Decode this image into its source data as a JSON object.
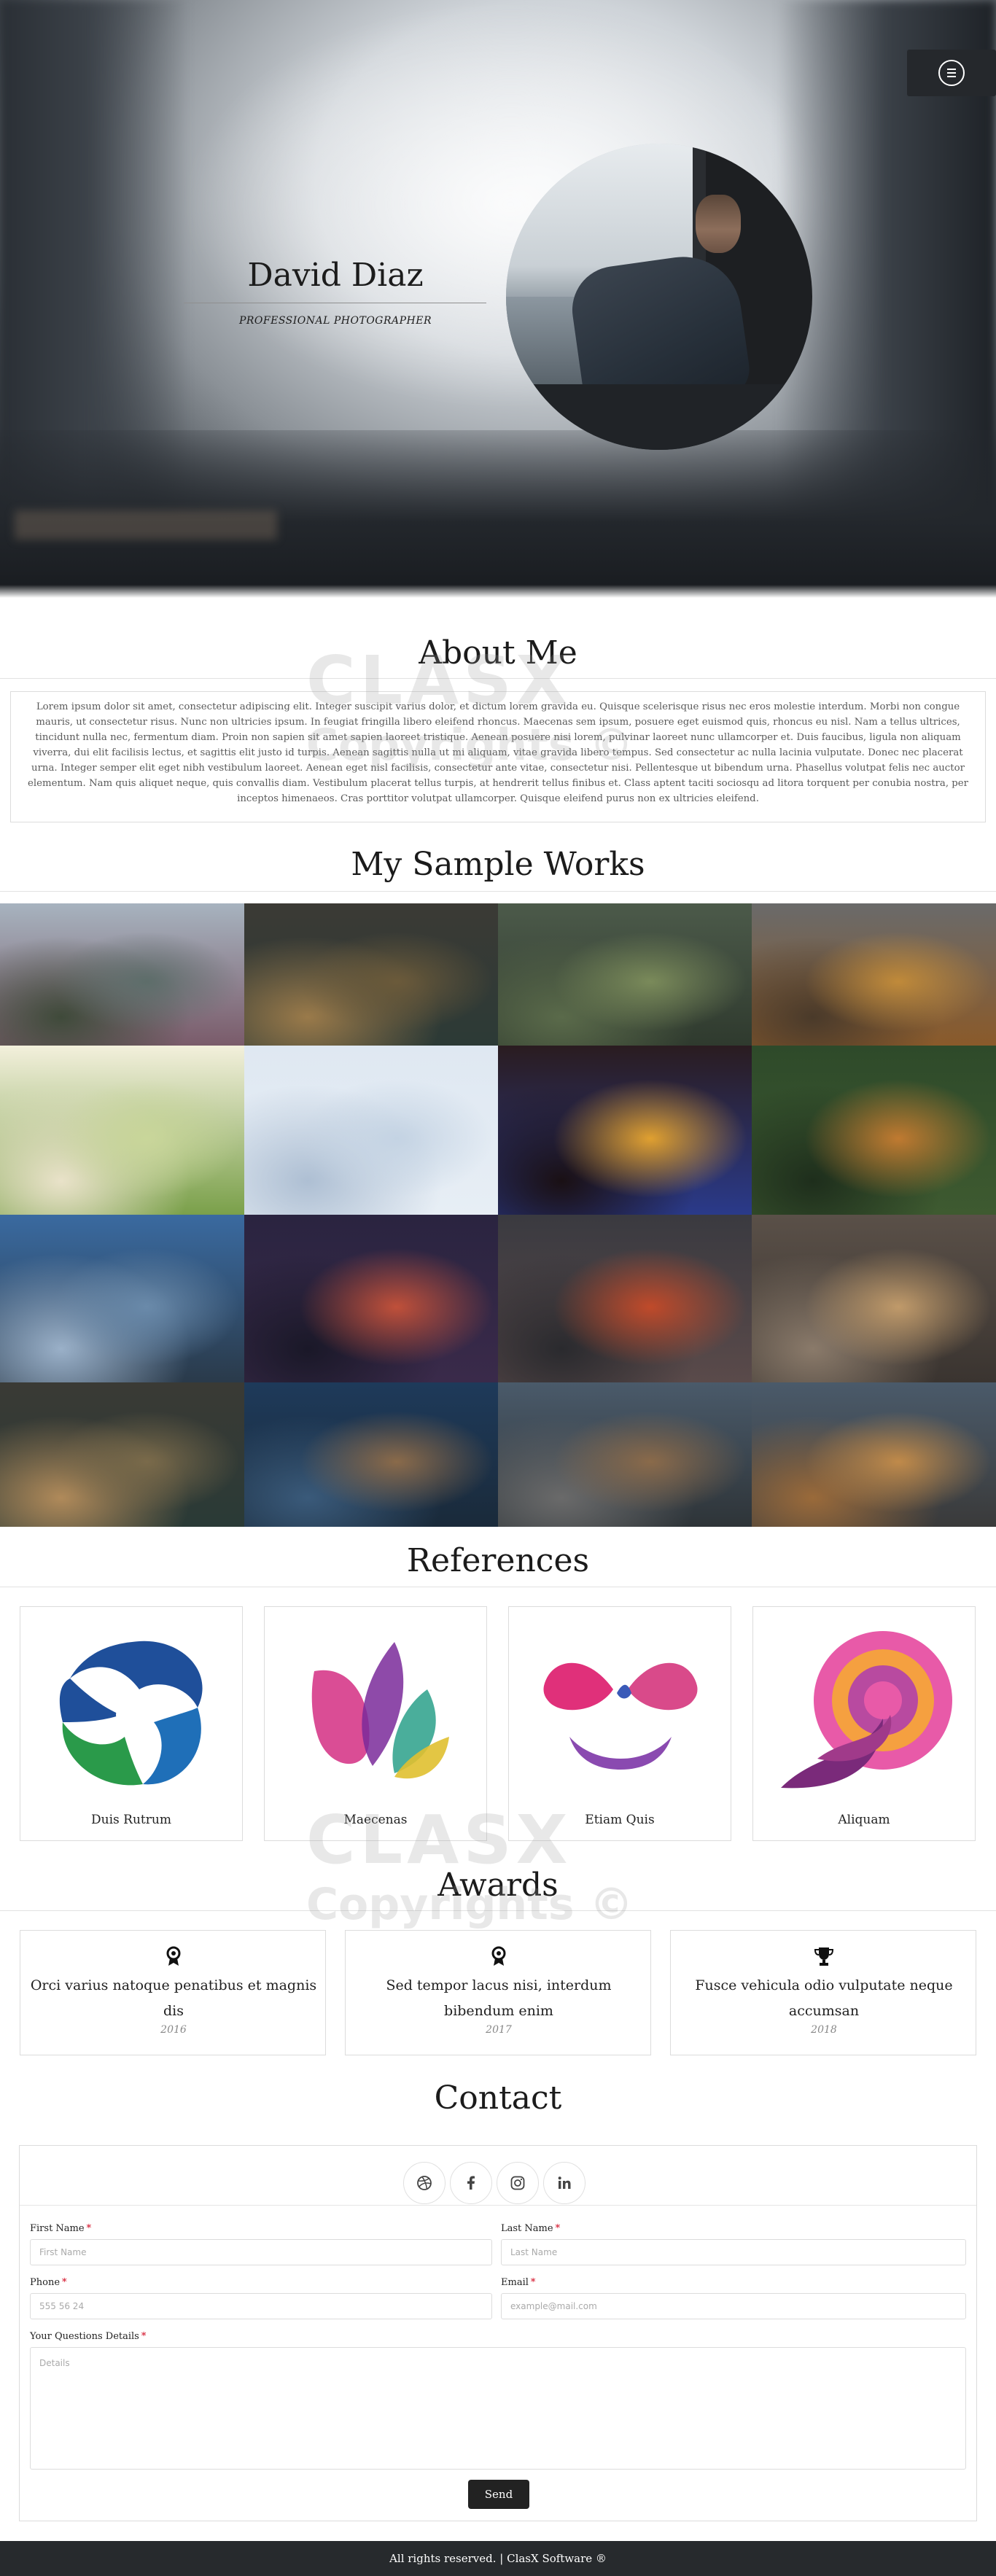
{
  "hero": {
    "name": "David Diaz",
    "subtitle": "PROFESSIONAL PHOTOGRAPHER"
  },
  "menu": {
    "icon": "menu-icon"
  },
  "about": {
    "title": "About Me",
    "text": "Lorem ipsum dolor sit amet, consectetur adipiscing elit. Integer suscipit varius dolor, et dictum lorem gravida eu. Quisque scelerisque risus nec eros molestie interdum. Morbi non congue mauris, ut consectetur risus. Nunc non ultricies ipsum. In feugiat fringilla libero eleifend rhoncus. Maecenas sem ipsum, posuere eget euismod quis, rhoncus eu nisl. Nam a tellus ultrices, tincidunt nulla nec, fermentum diam. Proin non sapien sit amet sapien laoreet tristique. Aenean posuere nisi lorem, pulvinar laoreet nunc ullamcorper et. Duis faucibus, ligula non aliquam viverra, dui elit facilisis lectus, et sagittis elit justo id turpis. Aenean sagittis nulla ut mi aliquam, vitae gravida libero tempus. Sed consectetur ac nulla lacinia vulputate. Donec nec placerat urna. Integer semper elit eget nibh vestibulum laoreet. Aenean eget nisl facilisis, consectetur ante vitae, consectetur nisi. Pellentesque ut bibendum urna. Phasellus volutpat felis nec auctor elementum. Nam quis aliquet neque, quis convallis diam. Vestibulum placerat tellus turpis, at hendrerit tellus finibus et. Class aptent taciti sociosqu ad litora torquent per conubia nostra, per inceptos himenaeos. Cras porttitor volutpat ullamcorper. Quisque eleifend purus non ex ultricies eleifend."
  },
  "works": {
    "title": "My Sample Works",
    "tiles": [
      {
        "name": "mountain-path-photo",
        "colors": [
          "#a7b3bf",
          "#5d6d6a",
          "#7a5b6a",
          "#3f4a3a"
        ]
      },
      {
        "name": "lake-tree-photo",
        "colors": [
          "#3b3a35",
          "#6b5a3a",
          "#2c3a36",
          "#9a7a4a"
        ]
      },
      {
        "name": "green-valley-photo",
        "colors": [
          "#4c5a4a",
          "#7a8a5a",
          "#2f3a2e",
          "#5a6a4a"
        ]
      },
      {
        "name": "canyon-sunset-photo",
        "colors": [
          "#6a6a6a",
          "#c08a3a",
          "#8a5a2a",
          "#4a3a2a"
        ]
      },
      {
        "name": "woman-meadow-photo",
        "colors": [
          "#f3f0dc",
          "#c9d69a",
          "#7aa04a",
          "#e9e2c9"
        ]
      },
      {
        "name": "arctic-fox-photo",
        "colors": [
          "#dfe8f2",
          "#c4d3e3",
          "#e7eef5",
          "#aebfd3"
        ]
      },
      {
        "name": "parrot-photo",
        "colors": [
          "#2a1c20",
          "#e0a030",
          "#2a3a8a",
          "#1a1014"
        ]
      },
      {
        "name": "tiger-photo",
        "colors": [
          "#2e4a2a",
          "#c07a30",
          "#3e5a30",
          "#1e2e1c"
        ]
      },
      {
        "name": "city-skyline-photo",
        "colors": [
          "#3a6aa0",
          "#6a8aaa",
          "#2a3a4a",
          "#9ab0c8"
        ]
      },
      {
        "name": "neon-street-photo",
        "colors": [
          "#2a2440",
          "#c0503a",
          "#3a2a4a",
          "#1a1828"
        ]
      },
      {
        "name": "paris-sunset-photo",
        "colors": [
          "#3a3a40",
          "#c04a2a",
          "#5a4a4a",
          "#2a2a2e"
        ]
      },
      {
        "name": "busy-street-photo",
        "colors": [
          "#5a5048",
          "#c09a6a",
          "#3a3430",
          "#8a7a6a"
        ]
      },
      {
        "name": "lake-house-photo",
        "colors": [
          "#3a3a35",
          "#7a6a4a",
          "#2a3a36",
          "#b08a5a"
        ]
      },
      {
        "name": "blue-room-photo",
        "colors": [
          "#1e3a5a",
          "#8a6a4a",
          "#1a2a3a",
          "#3a5a7a"
        ]
      },
      {
        "name": "bridge-city-photo",
        "colors": [
          "#4a5a6a",
          "#8a6a4a",
          "#2e3438",
          "#6a6a6a"
        ]
      },
      {
        "name": "canal-sunset-photo",
        "colors": [
          "#4a5a6a",
          "#c08a4a",
          "#3a3a3a",
          "#9a6a3a"
        ]
      }
    ]
  },
  "references": {
    "title": "References",
    "items": [
      {
        "label": "Duis Rutrum"
      },
      {
        "label": "Maecenas"
      },
      {
        "label": "Etiam Quis"
      },
      {
        "label": "Aliquam"
      }
    ]
  },
  "awards": {
    "title": "Awards",
    "items": [
      {
        "icon": "medal-icon",
        "title": "Orci varius natoque penatibus et magnis dis",
        "year": "2016"
      },
      {
        "icon": "medal-icon",
        "title": "Sed tempor lacus nisi, interdum bibendum enim",
        "year": "2017"
      },
      {
        "icon": "trophy-icon",
        "title": "Fusce vehicula odio vulputate neque accumsan",
        "year": "2018"
      }
    ]
  },
  "contact": {
    "title": "Contact",
    "social": [
      {
        "icon": "dribbble-icon"
      },
      {
        "icon": "facebook-icon"
      },
      {
        "icon": "instagram-icon"
      },
      {
        "icon": "linkedin-icon"
      }
    ],
    "first_name": {
      "label": "First Name",
      "placeholder": "First Name"
    },
    "last_name": {
      "label": "Last Name",
      "placeholder": "Last Name"
    },
    "phone": {
      "label": "Phone",
      "placeholder": "555 56 24"
    },
    "email": {
      "label": "Email",
      "placeholder": "example@mail.com"
    },
    "details": {
      "label": "Your Questions Details",
      "placeholder": "Details"
    },
    "required_mark": "*",
    "send": "Send"
  },
  "watermark": {
    "logo": "CLASX",
    "copyright": "Copyrights ©"
  },
  "footer": {
    "text": "All rights reserved. | ClasX Software ®"
  }
}
